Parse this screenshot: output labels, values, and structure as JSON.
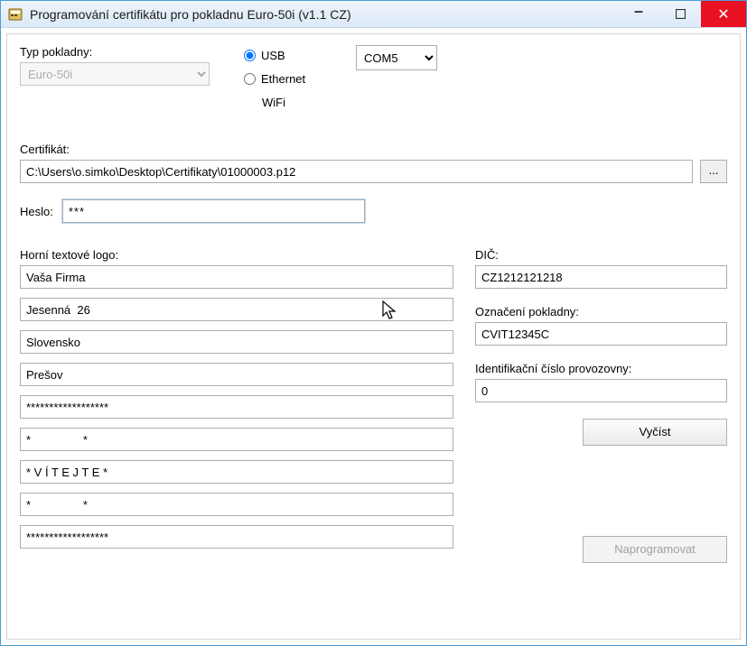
{
  "window": {
    "title": "Programování certifikátu pro pokladnu Euro-50i (v1.1 CZ)"
  },
  "typePokladny": {
    "label": "Typ pokladny:",
    "value": "Euro-50i"
  },
  "connection": {
    "usb": "USB",
    "ethernet": "Ethernet",
    "wifi": "WiFi",
    "comPort": "COM5"
  },
  "certifikat": {
    "label": "Certifikát:",
    "path": "C:\\Users\\o.simko\\Desktop\\Certifikaty\\01000003.p12",
    "browse": "..."
  },
  "heslo": {
    "label": "Heslo:",
    "value": "***"
  },
  "logo": {
    "label": "Horní textové logo:",
    "lines": [
      "Vaša Firma",
      "Jesenná  26",
      "Slovensko",
      "Prešov",
      "******************",
      "*                *",
      "* V Í T E J T E *",
      "*                *",
      "******************"
    ]
  },
  "dic": {
    "label": "DIČ:",
    "value": "CZ1212121218"
  },
  "oznaceni": {
    "label": "Označení pokladny:",
    "value": "CVIT12345C"
  },
  "idProvozovny": {
    "label": "Identifikační číslo provozovny:",
    "value": "0"
  },
  "buttons": {
    "vycist": "Vyčíst",
    "naprogramovat": "Naprogramovat"
  }
}
